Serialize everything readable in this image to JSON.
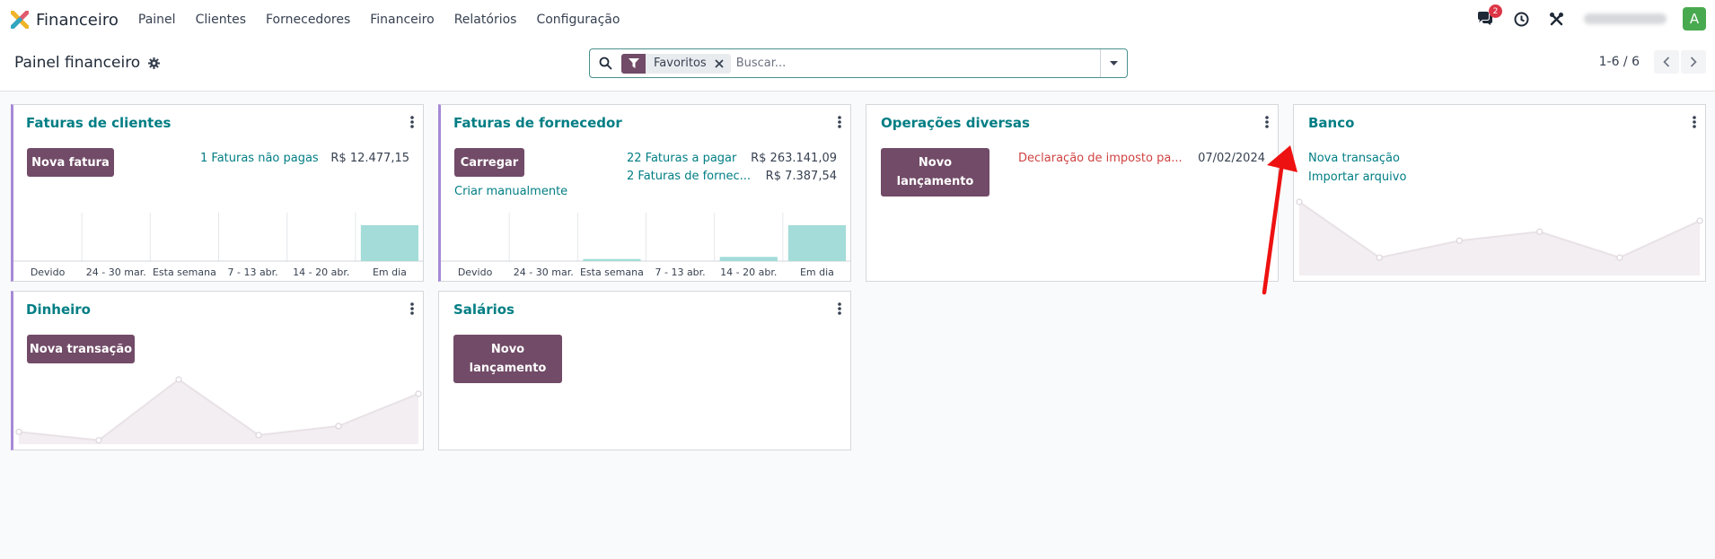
{
  "app": {
    "name": "Financeiro"
  },
  "menu": [
    "Painel",
    "Clientes",
    "Fornecedores",
    "Financeiro",
    "Relatórios",
    "Configuração"
  ],
  "systray": {
    "messages_count": "2",
    "avatar_letter": "A"
  },
  "control": {
    "title": "Painel financeiro",
    "facet_label": "Favoritos",
    "search_placeholder": "Buscar...",
    "pager": "1-6 / 6"
  },
  "cards": {
    "customers": {
      "title": "Faturas de clientes",
      "button": "Nova fatura",
      "unpaid_link": "1 Faturas não pagas",
      "unpaid_amount": "R$ 12.477,15"
    },
    "vendors": {
      "title": "Faturas de fornecedor",
      "button": "Carregar",
      "manual_link": "Criar manualmente",
      "to_pay_link": "22 Faturas a pagar",
      "to_pay_amount": "R$ 263.141,09",
      "late_link": "2 Faturas de fornec...",
      "late_amount": "R$ 7.387,54"
    },
    "misc": {
      "title": "Operações diversas",
      "button_line1": "Novo",
      "button_line2": "lançamento",
      "entry_label": "Declaração de imposto pa...",
      "entry_date": "07/02/2024"
    },
    "bank": {
      "title": "Banco",
      "link1": "Nova transação",
      "link2": "Importar arquivo"
    },
    "cash": {
      "title": "Dinheiro",
      "button": "Nova transação"
    },
    "salaries": {
      "title": "Salários",
      "button_line1": "Novo",
      "button_line2": "lançamento"
    }
  },
  "chart_data": [
    {
      "type": "bar",
      "categories": [
        "Devido",
        "24 - 30 mar.",
        "Esta semana",
        "7 - 13 abr.",
        "14 - 20 abr.",
        "Em dia"
      ],
      "values": [
        0,
        0,
        0,
        0,
        0,
        12477.15
      ]
    },
    {
      "type": "bar",
      "categories": [
        "Devido",
        "24 - 30 mar.",
        "Esta semana",
        "7 - 13 abr.",
        "14 - 20 abr.",
        "Em dia"
      ],
      "values": [
        0,
        0,
        2,
        0,
        4,
        34
      ]
    },
    {
      "type": "line",
      "values": [
        74,
        18,
        35,
        44,
        18,
        55
      ]
    },
    {
      "type": "line",
      "values": [
        19,
        6,
        100,
        14,
        28,
        78
      ]
    }
  ]
}
